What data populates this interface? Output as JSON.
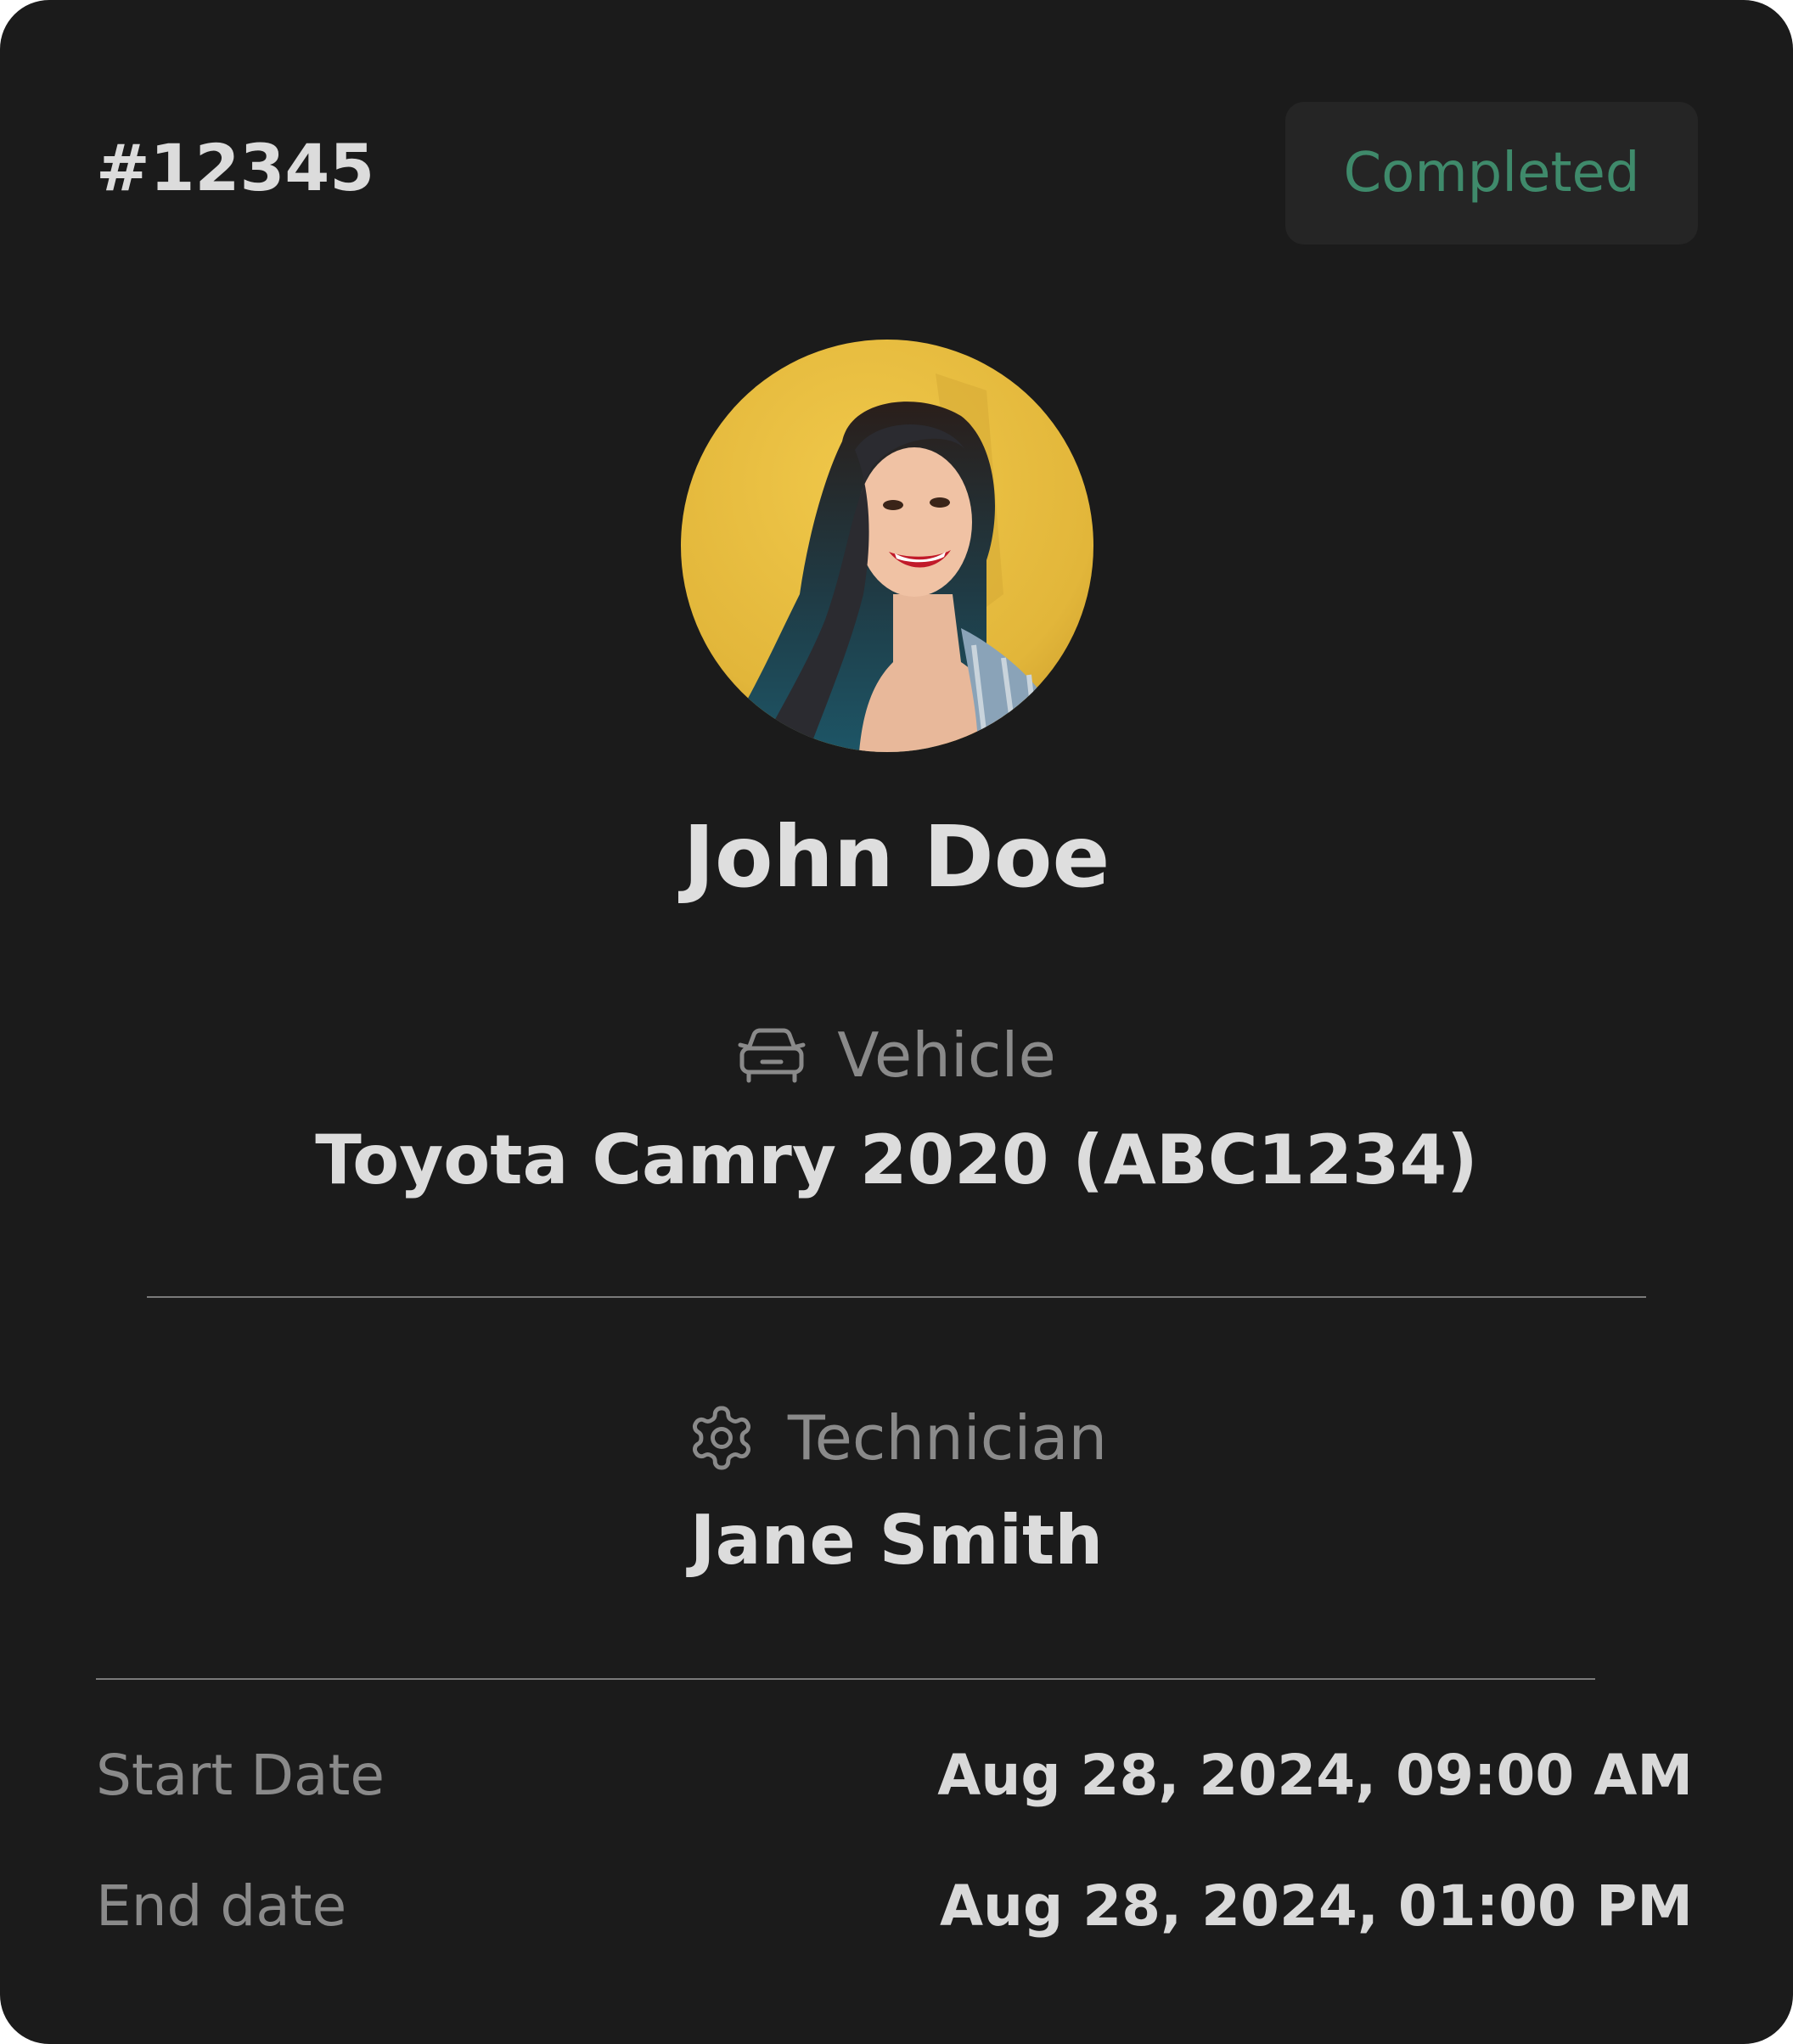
{
  "card": {
    "order_id": "#12345",
    "status": "Completed",
    "status_color": "#3f8a6b",
    "customer_name": "John Doe",
    "avatar_icon": "customer-photo"
  },
  "vehicle": {
    "icon": "car-icon",
    "label": "Vehicle",
    "value": "Toyota Camry 2020 (ABC1234)"
  },
  "technician": {
    "icon": "gear-icon",
    "label": "Technician",
    "value": "Jane Smith"
  },
  "dates": {
    "start_label": "Start Date",
    "start_value": "Aug 28, 2024, 09:00 AM",
    "end_label": "End date",
    "end_value": "Aug 28, 2024, 01:00 PM"
  }
}
